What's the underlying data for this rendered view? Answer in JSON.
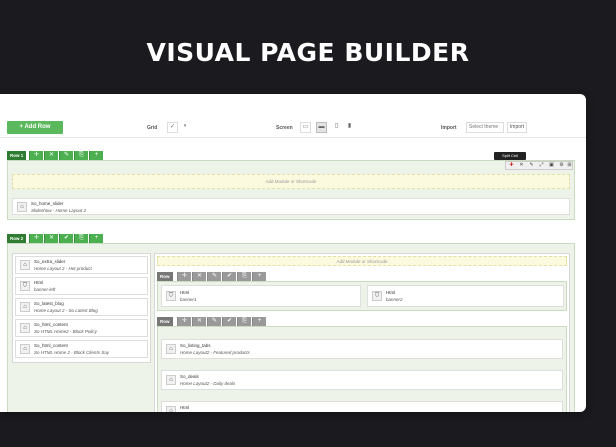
{
  "hero": {
    "title": "VISUAL PAGE BUILDER"
  },
  "toolbar": {
    "add_row": "+ Add Row",
    "grid_label": "Grid",
    "screen_label": "Screen",
    "import_label": "Import",
    "select_theme_placeholder": "Select theme",
    "import_button": "Import"
  },
  "tooltip": {
    "text": "Split Cell"
  },
  "rows": [
    {
      "label": "Row 1",
      "add_module": "Add Module or Shortcode",
      "modules": [
        {
          "name": "So_home_slider",
          "desc": "Slideshow - Home Layout 2"
        }
      ]
    },
    {
      "label": "Row 2",
      "left_modules": [
        {
          "name": "So_extra_slider",
          "desc": "Home Layout 2 - Hot product"
        },
        {
          "name": "Html",
          "desc": "banner-left"
        },
        {
          "name": "So_latest_blog",
          "desc": "Home Layout 2 - So Latest Blog"
        },
        {
          "name": "So_html_content",
          "desc": "So HTML Home2 - Block Policy"
        },
        {
          "name": "So_html_content",
          "desc": "So HTML Home 2 - Block Clients Say"
        }
      ],
      "add_module": "Add Module or Shortcode",
      "inner_rows": [
        {
          "label": "Row",
          "columns": [
            {
              "name": "Html",
              "desc": "banner1"
            },
            {
              "name": "Html",
              "desc": "banner2"
            }
          ]
        },
        {
          "label": "Row",
          "modules": [
            {
              "name": "So_listing_tabs",
              "desc": "Home Layout2 - Featured products"
            },
            {
              "name": "So_deals",
              "desc": "Home Layout2 - Daily deals"
            },
            {
              "name": "Html",
              "desc": ""
            }
          ]
        }
      ]
    }
  ]
}
